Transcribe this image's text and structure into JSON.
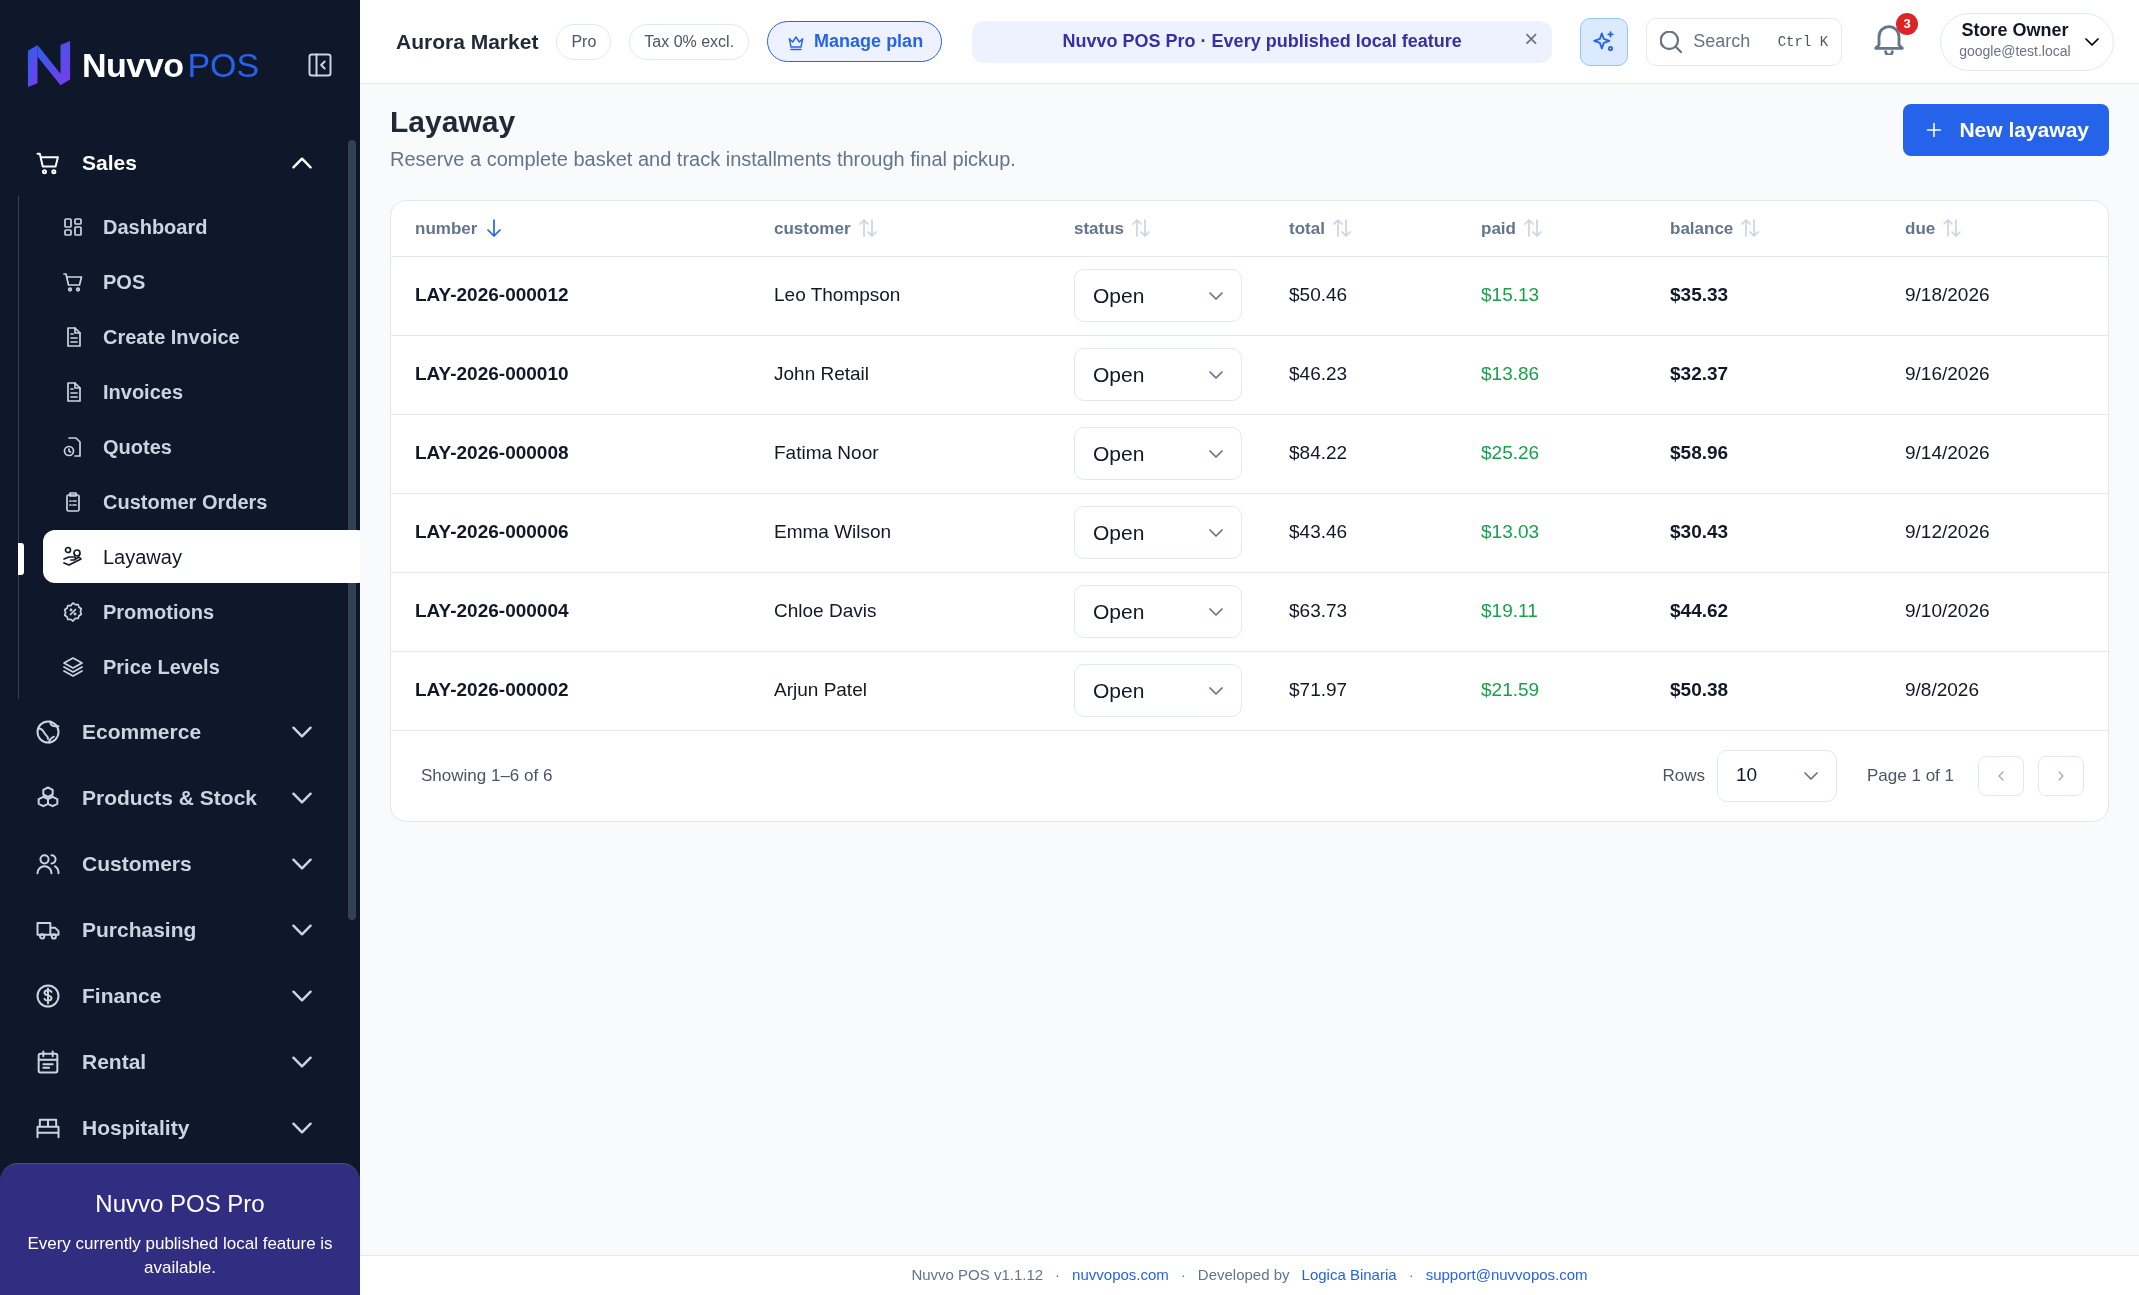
{
  "sidebar": {
    "logo": {
      "word": "Nuvvo",
      "suffix": "POS"
    },
    "groups": [
      {
        "label": "Sales",
        "expanded": true,
        "items": [
          {
            "label": "Dashboard",
            "selected": false
          },
          {
            "label": "POS",
            "selected": false
          },
          {
            "label": "Create Invoice",
            "selected": false
          },
          {
            "label": "Invoices",
            "selected": false
          },
          {
            "label": "Quotes",
            "selected": false
          },
          {
            "label": "Customer Orders",
            "selected": false
          },
          {
            "label": "Layaway",
            "selected": true
          },
          {
            "label": "Promotions",
            "selected": false
          },
          {
            "label": "Price Levels",
            "selected": false
          }
        ]
      },
      {
        "label": "Ecommerce",
        "expanded": false
      },
      {
        "label": "Products & Stock",
        "expanded": false
      },
      {
        "label": "Customers",
        "expanded": false
      },
      {
        "label": "Purchasing",
        "expanded": false
      },
      {
        "label": "Finance",
        "expanded": false
      },
      {
        "label": "Rental",
        "expanded": false
      },
      {
        "label": "Hospitality",
        "expanded": false
      }
    ],
    "promo": {
      "title": "Nuvvo POS Pro",
      "text": "Every currently published local feature is available."
    }
  },
  "topbar": {
    "store": "Aurora Market",
    "badges": [
      "Pro",
      "Tax 0% excl."
    ],
    "plan_button": "Manage plan",
    "banner": {
      "text": "Nuvvo POS Pro · Every published local feature",
      "close": "×"
    },
    "search": {
      "placeholder": "Search",
      "shortcut": "Ctrl K"
    },
    "notifications": "3",
    "user": {
      "name": "Store Owner",
      "email": "google@test.local"
    }
  },
  "page": {
    "title": "Layaway",
    "subtitle": "Reserve a complete basket and track installments through final pickup.",
    "new_button": "New layaway"
  },
  "table": {
    "columns": [
      {
        "label": "number",
        "sorted": true
      },
      {
        "label": "customer",
        "sorted": false
      },
      {
        "label": "status",
        "sorted": false
      },
      {
        "label": "total",
        "sorted": false
      },
      {
        "label": "paid",
        "sorted": false
      },
      {
        "label": "balance",
        "sorted": false
      },
      {
        "label": "due",
        "sorted": false
      }
    ],
    "rows": [
      {
        "number": "LAY-2026-000012",
        "customer": "Leo Thompson",
        "status": "Open",
        "total": "$50.46",
        "paid": "$15.13",
        "balance": "$35.33",
        "due": "9/18/2026"
      },
      {
        "number": "LAY-2026-000010",
        "customer": "John Retail",
        "status": "Open",
        "total": "$46.23",
        "paid": "$13.86",
        "balance": "$32.37",
        "due": "9/16/2026"
      },
      {
        "number": "LAY-2026-000008",
        "customer": "Fatima Noor",
        "status": "Open",
        "total": "$84.22",
        "paid": "$25.26",
        "balance": "$58.96",
        "due": "9/14/2026"
      },
      {
        "number": "LAY-2026-000006",
        "customer": "Emma Wilson",
        "status": "Open",
        "total": "$43.46",
        "paid": "$13.03",
        "balance": "$30.43",
        "due": "9/12/2026"
      },
      {
        "number": "LAY-2026-000004",
        "customer": "Chloe Davis",
        "status": "Open",
        "total": "$63.73",
        "paid": "$19.11",
        "balance": "$44.62",
        "due": "9/10/2026"
      },
      {
        "number": "LAY-2026-000002",
        "customer": "Arjun Patel",
        "status": "Open",
        "total": "$71.97",
        "paid": "$21.59",
        "balance": "$50.38",
        "due": "9/8/2026"
      }
    ],
    "footer": {
      "showing": "Showing 1–6 of 6",
      "rows_label": "Rows",
      "rows_value": "10",
      "page": "Page 1 of 1",
      "prev_disabled": true,
      "next_disabled": true
    }
  },
  "app_footer": [
    {
      "kind": "text",
      "text": "Nuvvo POS v1.1.12"
    },
    {
      "kind": "sep",
      "text": "·"
    },
    {
      "kind": "link",
      "text": "nuvvopos.com"
    },
    {
      "kind": "sep",
      "text": "·"
    },
    {
      "kind": "text",
      "text": "Developed by"
    },
    {
      "kind": "link",
      "text": "Logica Binaria"
    },
    {
      "kind": "sep",
      "text": "·"
    },
    {
      "kind": "link",
      "text": "support@nuvvopos.com"
    }
  ]
}
